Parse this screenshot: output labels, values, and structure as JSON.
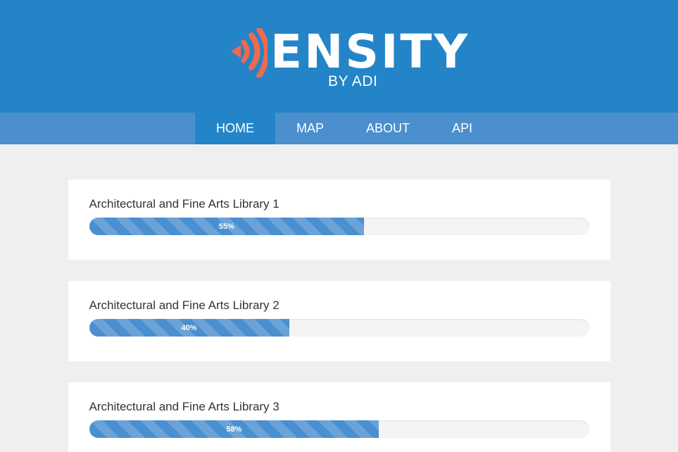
{
  "header": {
    "logo_word": "ENSITY",
    "logo_sub": "BY ADI",
    "logo_icon": "wifi-signal-d-icon",
    "bg_color": "#2385c8",
    "accent_color": "#ef6a4f"
  },
  "nav": {
    "items": [
      {
        "label": "HOME",
        "active": true
      },
      {
        "label": "MAP",
        "active": false
      },
      {
        "label": "ABOUT",
        "active": false
      },
      {
        "label": "API",
        "active": false
      }
    ]
  },
  "libraries": [
    {
      "name": "Architectural and Fine Arts Library 1",
      "percent_label": "55%",
      "percent": 55
    },
    {
      "name": "Architectural and Fine Arts Library 2",
      "percent_label": "40%",
      "percent": 40
    },
    {
      "name": "Architectural and Fine Arts Library 3",
      "percent_label": "58%",
      "percent": 58
    }
  ]
}
